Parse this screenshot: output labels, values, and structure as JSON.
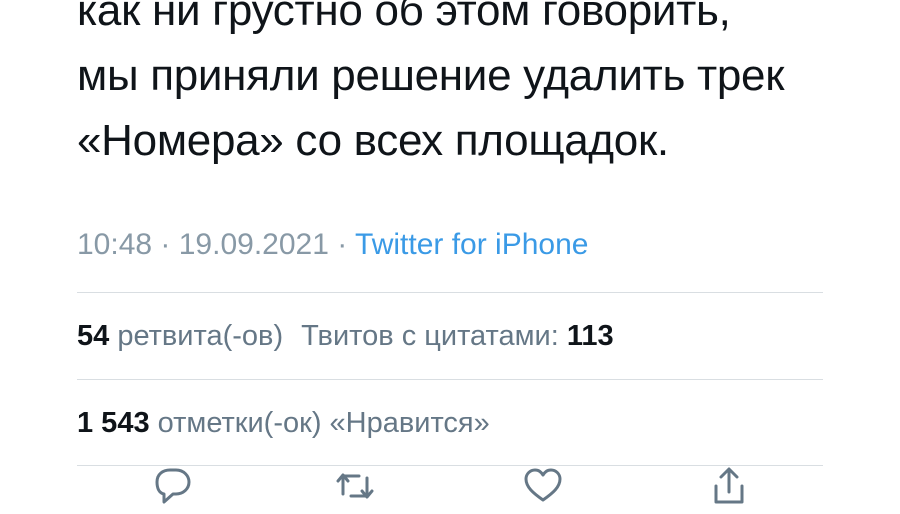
{
  "tweet": {
    "lines": [
      "как ни грустно об этом говорить,",
      "мы приняли решение удалить трек",
      "«Номера» со всех площадок."
    ],
    "time": "10:48",
    "separator_1": " · ",
    "date": "19.09.2021",
    "separator_2": " · ",
    "source": "Twitter for iPhone"
  },
  "stats": {
    "retweets_count": "54",
    "retweets_label": "ретвита(-ов)",
    "quotes_label": "Твитов с цитатами:",
    "quotes_count": "113",
    "likes_count": "1 543",
    "likes_label": "отметки(-ок) «Нравится»"
  },
  "actions": {
    "icons": [
      "reply-icon",
      "retweet-icon",
      "like-icon",
      "share-icon"
    ]
  },
  "colors": {
    "text": "#0f1419",
    "secondary": "#8899a6",
    "link": "#3a9ae6",
    "divider": "#d9dee2"
  }
}
